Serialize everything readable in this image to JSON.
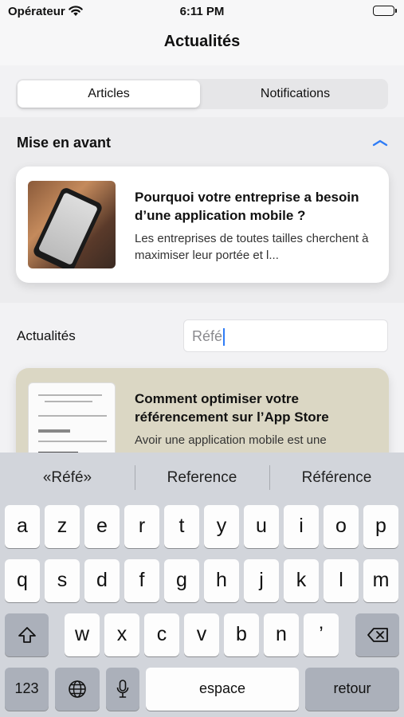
{
  "status_bar": {
    "carrier": "Opérateur",
    "time": "6:11 PM"
  },
  "nav": {
    "title": "Actualités"
  },
  "segments": {
    "articles": "Articles",
    "notifications": "Notifications"
  },
  "featured": {
    "section_title": "Mise en avant",
    "card": {
      "title": "Pourquoi votre entreprise a besoin d’une application mobile ?",
      "description": "Les entreprises de toutes tailles cherchent à maximiser leur portée et l..."
    }
  },
  "filter": {
    "label": "Actualités",
    "search_value": "Réfé"
  },
  "news_card": {
    "title": "Comment optimiser votre référencement sur l’App Store",
    "description": "Avoir une application mobile est une"
  },
  "keyboard": {
    "suggestions": [
      "«Réfé»",
      "Reference",
      "Référence"
    ],
    "row1": [
      "a",
      "z",
      "e",
      "r",
      "t",
      "y",
      "u",
      "i",
      "o",
      "p"
    ],
    "row2": [
      "q",
      "s",
      "d",
      "f",
      "g",
      "h",
      "j",
      "k",
      "l",
      "m"
    ],
    "row3": [
      "w",
      "x",
      "c",
      "v",
      "b",
      "n",
      "’"
    ],
    "numbers_key": "123",
    "space_key": "espace",
    "return_key": "retour"
  },
  "colors": {
    "accent": "#2f7cf6",
    "news_card_bg": "#dbd7c4"
  }
}
